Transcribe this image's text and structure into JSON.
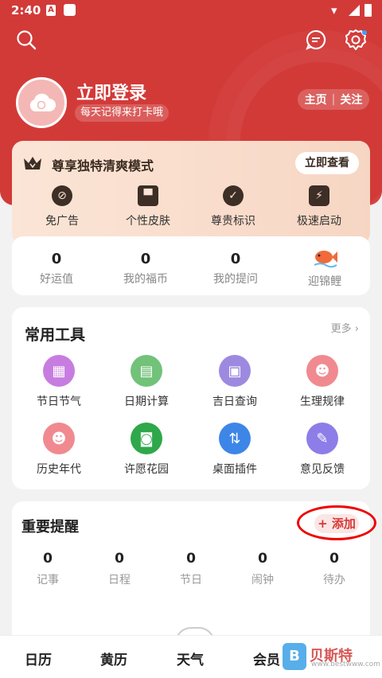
{
  "status": {
    "time": "2:40",
    "notif_letter": "A"
  },
  "header": {
    "login_title": "立即登录",
    "login_subtitle": "每天记得来打卡哦",
    "home": "主页",
    "follow": "关注"
  },
  "vip": {
    "title": "尊享独特清爽模式",
    "button": "立即查看",
    "features": [
      {
        "icon": "no-ads-icon",
        "label": "免广告"
      },
      {
        "icon": "tshirt-icon",
        "label": "个性皮肤"
      },
      {
        "icon": "vip-badge-icon",
        "label": "尊贵标识"
      },
      {
        "icon": "lightning-icon",
        "label": "极速启动"
      }
    ]
  },
  "stats": [
    {
      "num": "0",
      "label": "好运值"
    },
    {
      "num": "0",
      "label": "我的福币"
    },
    {
      "num": "0",
      "label": "我的提问"
    },
    {
      "label": "迎锦鲤"
    }
  ],
  "tools": {
    "title": "常用工具",
    "more": "更多 ›",
    "items": [
      {
        "label": "节日节气",
        "icon": "calendar-icon",
        "color": "#c77de0"
      },
      {
        "label": "日期计算",
        "icon": "calculator-icon",
        "color": "#72c27a"
      },
      {
        "label": "吉日查询",
        "icon": "lucky-day-icon",
        "color": "#9d8ae0"
      },
      {
        "label": "生理规律",
        "icon": "woman-profile-icon",
        "color": "#f08a90"
      },
      {
        "label": "历史年代",
        "icon": "history-icon",
        "color": "#f08a90"
      },
      {
        "label": "许愿花园",
        "icon": "wish-jar-icon",
        "color": "#2ea84a"
      },
      {
        "label": "桌面插件",
        "icon": "widget-icon",
        "color": "#3d86e8"
      },
      {
        "label": "意见反馈",
        "icon": "brush-icon",
        "color": "#8d7de8"
      }
    ]
  },
  "reminders": {
    "title": "重要提醒",
    "add": "+ 添加",
    "items": [
      {
        "num": "0",
        "label": "记事"
      },
      {
        "num": "0",
        "label": "日程"
      },
      {
        "num": "0",
        "label": "节日"
      },
      {
        "num": "0",
        "label": "闹钟"
      },
      {
        "num": "0",
        "label": "待办"
      }
    ]
  },
  "tabs": [
    "日历",
    "黄历",
    "天气",
    "会员"
  ],
  "watermark": {
    "text": "贝斯特",
    "url": "www.bestwww.com"
  },
  "colors": {
    "brand_red": "#d23a38"
  }
}
